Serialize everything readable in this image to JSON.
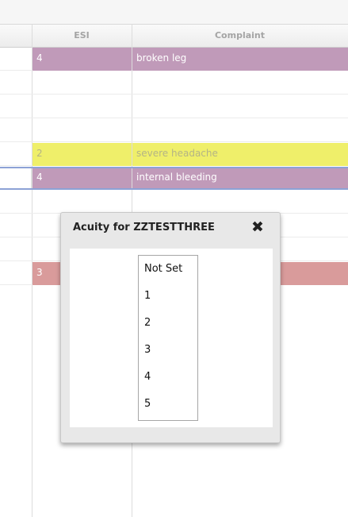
{
  "grid": {
    "headers": [
      "",
      "ESI",
      "Complaint"
    ],
    "rows": [
      {
        "esi": "4",
        "complaint": "broken leg",
        "style": "purple"
      },
      {
        "esi": "",
        "complaint": "",
        "style": "blank"
      },
      {
        "esi": "",
        "complaint": "",
        "style": "blank"
      },
      {
        "esi": "",
        "complaint": "",
        "style": "blank"
      },
      {
        "esi": "2",
        "complaint": "severe headache",
        "style": "yellow"
      },
      {
        "esi": "4",
        "complaint": "internal bleeding",
        "style": "selected"
      },
      {
        "esi": "",
        "complaint": "",
        "style": "blank"
      },
      {
        "esi": "",
        "complaint": "",
        "style": "blank"
      },
      {
        "esi": "",
        "complaint": "",
        "style": "blank"
      },
      {
        "esi": "3",
        "complaint": "",
        "style": "red"
      }
    ],
    "colors": {
      "purple": "#c09ab9",
      "yellow": "#efef6a",
      "red": "#d99b9b",
      "selection_border": "#8da2d6"
    }
  },
  "popup": {
    "title": "Acuity for ZZTESTTHREE",
    "close_icon": "close-x-icon",
    "close_glyph": "✖",
    "options": [
      "Not Set",
      "1",
      "2",
      "3",
      "4",
      "5"
    ]
  }
}
